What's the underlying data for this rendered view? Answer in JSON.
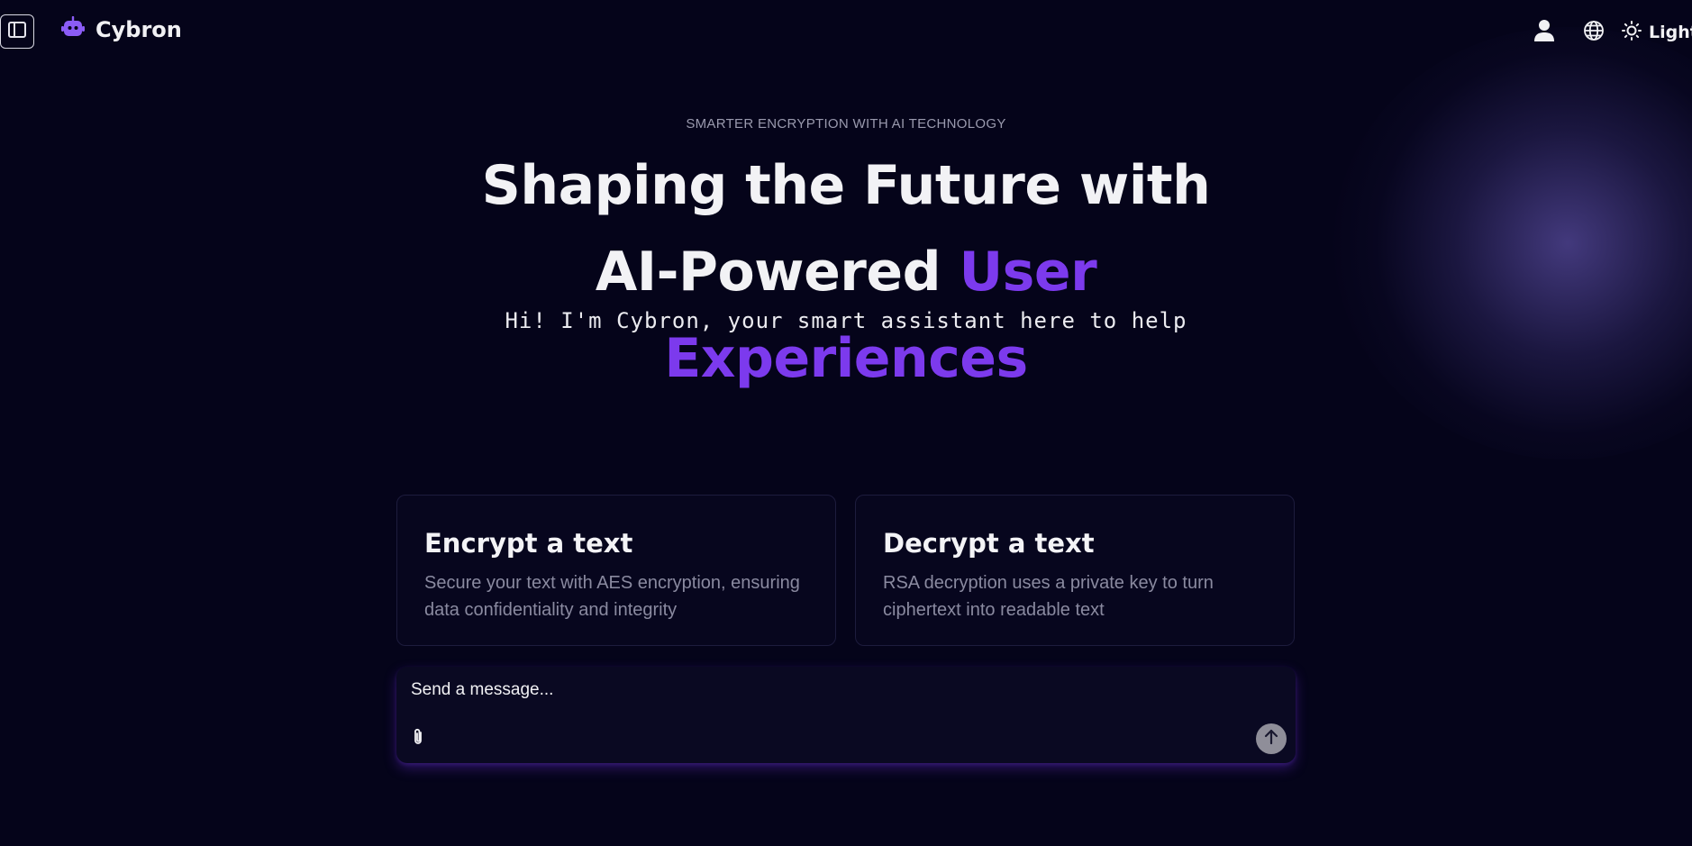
{
  "header": {
    "brand_name": "Cybron",
    "theme_label": "Light",
    "icons": {
      "sidebar_toggle": "sidebar-toggle-icon",
      "brand": "robot-icon",
      "user": "user-icon",
      "language": "globe-icon",
      "theme": "sun-icon"
    }
  },
  "hero": {
    "eyebrow": "SMARTER ENCRYPTION WITH AI TECHNOLOGY",
    "headline_part1": "Shaping the Future with AI-Powered",
    "headline_accent": "User Experiences",
    "subheading": "Hi! I'm Cybron, your smart assistant here to help"
  },
  "cards": [
    {
      "title": "Encrypt a text",
      "description": "Secure your text with AES encryption, ensuring data confidentiality and integrity"
    },
    {
      "title": "Decrypt a text",
      "description": "RSA decryption uses a private key to turn ciphertext into readable text"
    }
  ],
  "composer": {
    "placeholder": "Send a message...",
    "icons": {
      "attach": "paperclip-icon",
      "send": "arrow-up-icon"
    }
  },
  "colors": {
    "background": "#05041a",
    "accent": "#7c3aed",
    "brand_icon": "#8b5cf6",
    "muted_text": "#8a8aa0",
    "send_button": "#8f8e99"
  }
}
